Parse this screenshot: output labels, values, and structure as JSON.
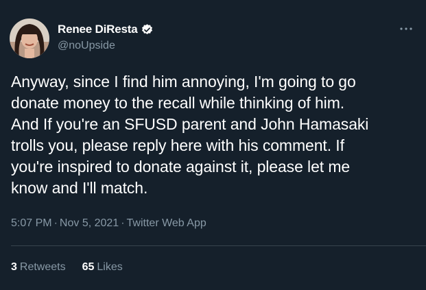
{
  "user": {
    "display_name": "Renee DiResta",
    "handle": "@noUpside",
    "verified": true,
    "avatar_icon": "user-avatar"
  },
  "tweet": {
    "text": "Anyway, since I find him annoying, I'm going to go\ndonate money to the recall while thinking of him.\nAnd If you're an SFUSD parent and John Hamasaki\ntrolls you, please reply here with his comment. If\nyou're inspired to donate against it, please let me\nknow and I'll match."
  },
  "meta": {
    "time": "5:07 PM",
    "separator": "·",
    "date": "Nov 5, 2021",
    "source": "Twitter Web App"
  },
  "stats": {
    "retweets_count": "3",
    "retweets_label": "Retweets",
    "likes_count": "65",
    "likes_label": "Likes"
  },
  "icons": {
    "more": "more-icon",
    "verified": "verified-badge-icon"
  },
  "colors": {
    "background": "#15202b",
    "secondary_text": "#8899a6",
    "divider": "#38444d",
    "verified_blue": "#ffffff"
  }
}
